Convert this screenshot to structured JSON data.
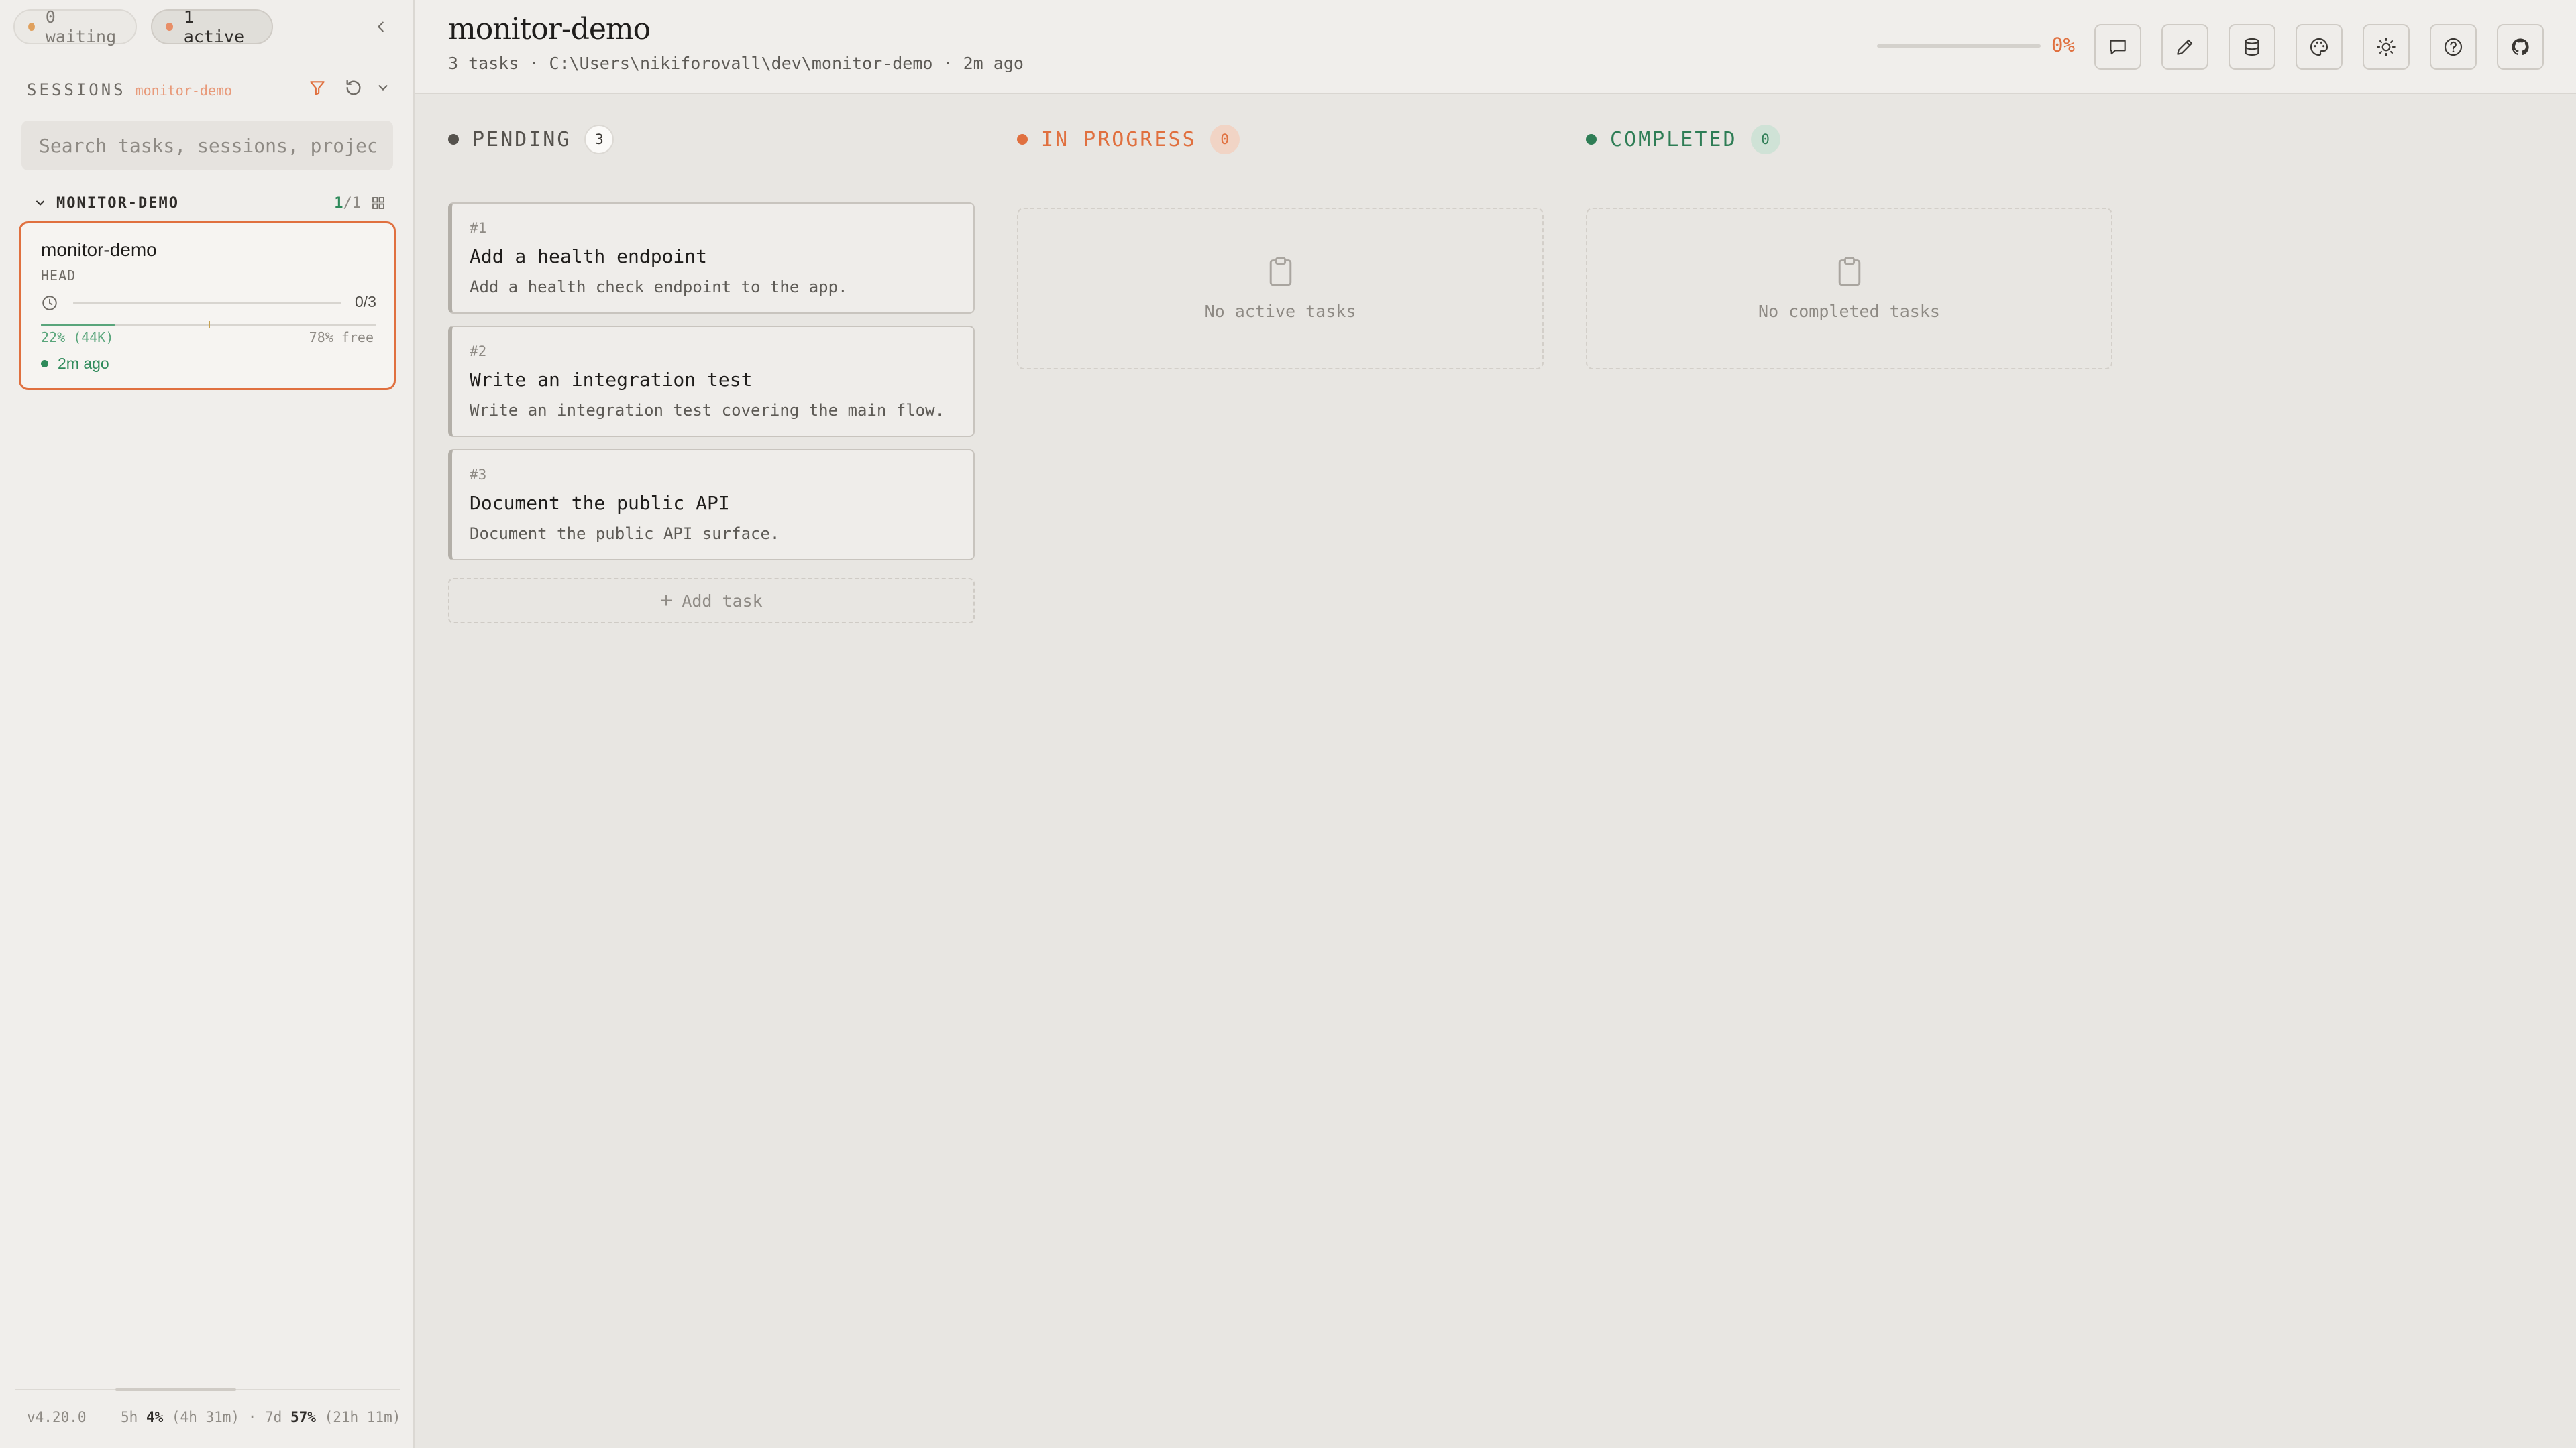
{
  "sidebar": {
    "pills": {
      "waiting": "0 waiting",
      "active": "1 active"
    },
    "sessions_label": "SESSIONS",
    "sessions_project": "monitor-demo",
    "search_placeholder": "Search tasks, sessions, projects",
    "group": {
      "name": "MONITOR-DEMO",
      "count_active": "1",
      "count_sep": "/",
      "count_total": "1"
    },
    "session": {
      "title": "monitor-demo",
      "branch": "HEAD",
      "progress_text": "0/3",
      "progress_fraction": 0,
      "context_used_fraction": 0.22,
      "context_left": "22% (44K)",
      "context_right": "78% free",
      "time": "2m ago"
    },
    "footer": {
      "version": "v4.20.0",
      "w5h_label": "5h",
      "w5h_pct": "4%",
      "w5h_reset": "(4h 31m)",
      "sep": "·",
      "w7d_label": "7d",
      "w7d_pct": "57%",
      "w7d_reset": "(21h 11m)"
    }
  },
  "header": {
    "title": "monitor-demo",
    "meta": "3 tasks · C:\\Users\\nikiforovall\\dev\\monitor-demo · 2m ago",
    "progress_percent": "0%",
    "progress_fraction": 0,
    "buttons": [
      "chat-icon",
      "pencil-icon",
      "database-icon",
      "palette-icon",
      "sun-icon",
      "help-icon",
      "github-icon"
    ]
  },
  "columns": {
    "pending": {
      "title": "PENDING",
      "count": "3",
      "color": "#55524d"
    },
    "in_progress": {
      "title": "IN PROGRESS",
      "count": "0",
      "color": "#e0703f",
      "empty": "No active tasks"
    },
    "completed": {
      "title": "COMPLETED",
      "count": "0",
      "color": "#2e7d55",
      "empty": "No completed tasks"
    }
  },
  "tasks": [
    {
      "id": "#1",
      "title": "Add a health endpoint",
      "desc": "Add a health check endpoint to the app."
    },
    {
      "id": "#2",
      "title": "Write an integration test",
      "desc": "Write an integration test covering the main flow."
    },
    {
      "id": "#3",
      "title": "Document the public API",
      "desc": "Document the public API surface."
    }
  ],
  "add_task_label": "Add task"
}
